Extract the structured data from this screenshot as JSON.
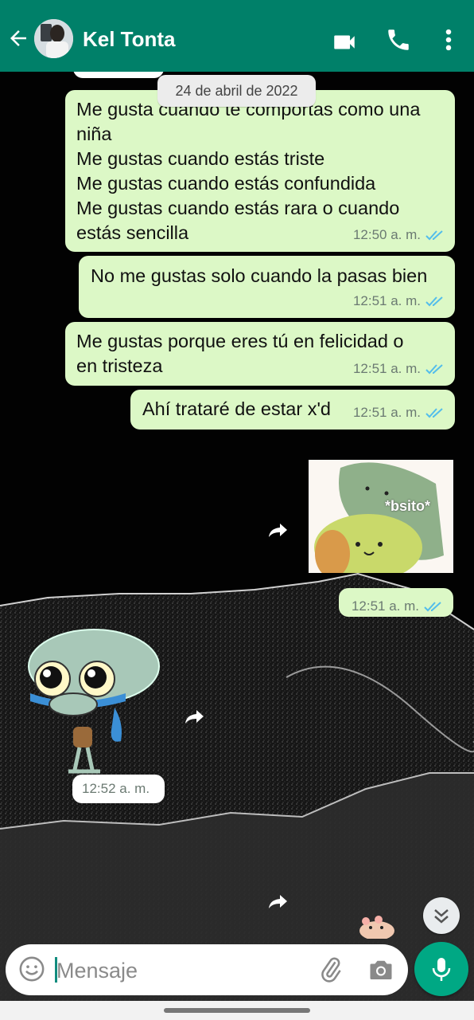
{
  "header": {
    "contact_name": "Kel Tonta",
    "back_icon": "arrow-left-icon",
    "video_icon": "video-camera-icon",
    "call_icon": "phone-icon",
    "menu_icon": "more-vertical-icon",
    "background_color": "#008069"
  },
  "chat": {
    "date_label": "24 de abril de 2022",
    "messages": [
      {
        "direction": "outgoing",
        "text": "Me gusta cuando te comportas como una niña\nMe gustas cuando estás triste\nMe gustas cuando estás confundida\nMe gustas cuando estás rara o cuando estás sencilla",
        "time": "12:50 a. m.",
        "status": "read"
      },
      {
        "direction": "outgoing",
        "text": "No me gustas solo cuando la pasas bien",
        "time": "12:51 a. m.",
        "status": "read"
      },
      {
        "direction": "outgoing",
        "text": "Me gustas porque eres tú en felicidad o en tristeza",
        "time": "12:51 a. m.",
        "status": "read"
      },
      {
        "direction": "outgoing",
        "text": "Ahí trataré de estar x'd",
        "time": "12:51 a. m.",
        "status": "read"
      },
      {
        "direction": "outgoing",
        "type": "image",
        "caption_in_image": "*bsito*",
        "time": "12:51 a. m.",
        "status": "read"
      },
      {
        "direction": "incoming",
        "type": "sticker",
        "sticker": "crying-squidward-sticker",
        "time": "12:52 a. m."
      }
    ]
  },
  "input": {
    "placeholder": "Mensaje",
    "emoji_icon": "emoji-icon",
    "attach_icon": "paperclip-icon",
    "camera_icon": "camera-icon",
    "mic_icon": "microphone-icon"
  },
  "colors": {
    "outgoing_bubble": "#dcf8c6",
    "incoming_bubble": "#ffffff",
    "read_tick": "#53bdeb",
    "accent": "#00a884"
  }
}
